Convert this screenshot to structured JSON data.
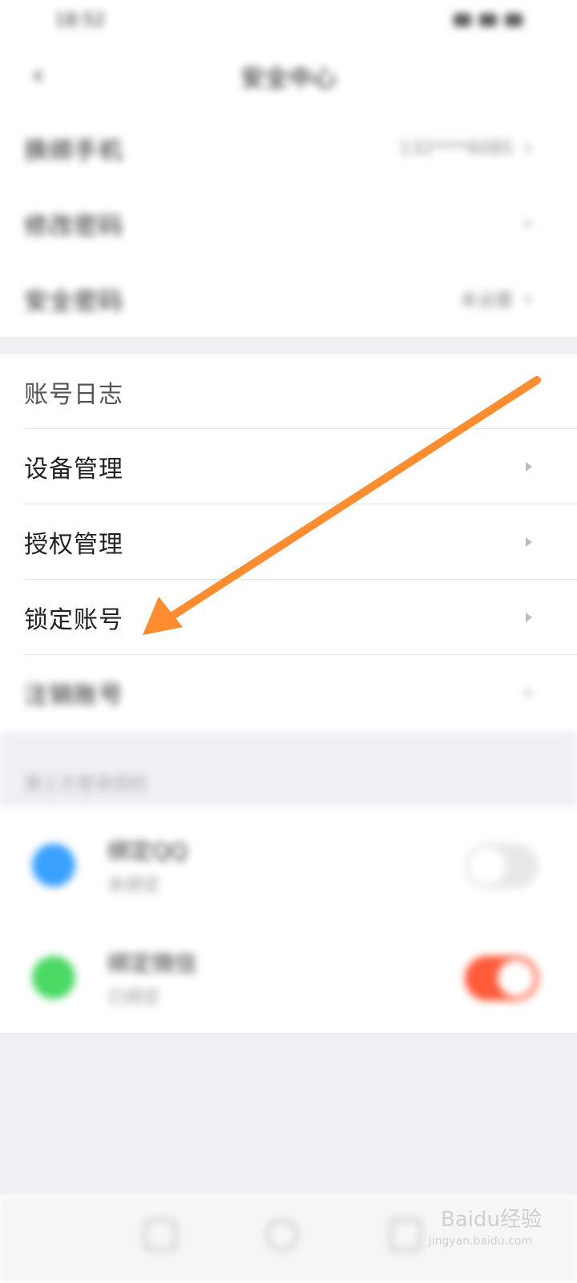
{
  "status_bar": {
    "time": "18:52",
    "signal": "status icons"
  },
  "header": {
    "title": "安全中心"
  },
  "rows_top": [
    {
      "label": "换绑手机",
      "value": "132****6085"
    },
    {
      "label": "修改密码",
      "value": ""
    },
    {
      "label": "安全密码",
      "value": "未设置"
    }
  ],
  "rows_mid": [
    {
      "label": "账号日志"
    },
    {
      "label": "设备管理"
    },
    {
      "label": "授权管理"
    },
    {
      "label": "锁定账号"
    },
    {
      "label": "注销账号"
    }
  ],
  "login_section": {
    "label": "第三方登录授权"
  },
  "apps": [
    {
      "title": "绑定QQ",
      "sub": "未绑定",
      "color": "#3aa1ff",
      "toggle_on": false
    },
    {
      "title": "绑定微信",
      "sub": "已绑定",
      "color": "#4cd964",
      "toggle_on": true
    }
  ],
  "colors": {
    "arrow": "#ff8c2e",
    "toggle_on": "#ff5a3a",
    "toggle_off": "#e8e8e8"
  },
  "watermark": {
    "brand": "Baidu经验",
    "url": "jingyan.baidu.com"
  }
}
